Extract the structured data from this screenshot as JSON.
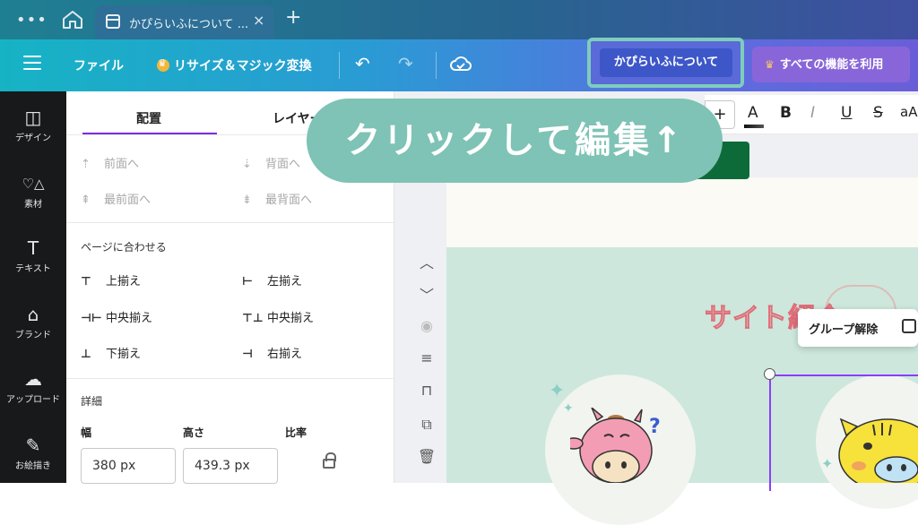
{
  "browser": {
    "menu_glyph": "•••",
    "tab_title": "かぴらいふについて ...",
    "tab_close": "×",
    "new_tab": "+"
  },
  "toolbar": {
    "file_label": "ファイル",
    "resize_label": "リサイズ＆マジック変換",
    "undo_glyph": "↶",
    "redo_glyph": "↷",
    "design_title": "かぴらいふについて",
    "premium_label": "すべての機能を利用"
  },
  "rail": {
    "items": [
      {
        "icon": "design-icon",
        "glyph": "◫",
        "label": "デザイン"
      },
      {
        "icon": "elements-icon",
        "glyph": "♡△",
        "label": "素材"
      },
      {
        "icon": "text-icon",
        "glyph": "T",
        "label": "テキスト"
      },
      {
        "icon": "brand-icon",
        "glyph": "⌂",
        "label": "ブランド"
      },
      {
        "icon": "upload-icon",
        "glyph": "☁",
        "label": "アップロード"
      },
      {
        "icon": "draw-icon",
        "glyph": "✎",
        "label": "お絵描き"
      }
    ]
  },
  "panel": {
    "tabs": {
      "arrange": "配置",
      "layers": "レイヤー"
    },
    "layer_actions": {
      "forward": "前面へ",
      "backward": "背面へ",
      "to_front": "最前面へ",
      "to_back": "最背面へ"
    },
    "align_section": "ページに合わせる",
    "align": {
      "top": "上揃え",
      "left": "左揃え",
      "middle": "中央揃え",
      "center": "中央揃え",
      "bottom": "下揃え",
      "right": "右揃え"
    },
    "details_section": "詳細",
    "width_label": "幅",
    "height_label": "高さ",
    "ratio_label": "比率",
    "width_value": "380 px",
    "height_value": "439.3 px"
  },
  "format_bar": {
    "plus": "+",
    "color": "A",
    "bold": "B",
    "italic": "I",
    "underline": "U",
    "strike": "S",
    "case": "aA"
  },
  "canvas": {
    "page_heading": "サイト紹介",
    "context_menu_label": "グループ解除"
  },
  "callout": {
    "text": "クリックして編集↑"
  },
  "colors": {
    "accent_purple": "#7d2ae8",
    "callout_teal": "#7ec3b5",
    "toolbar_start": "#16b3c4",
    "toolbar_end": "#6a5ed8"
  }
}
